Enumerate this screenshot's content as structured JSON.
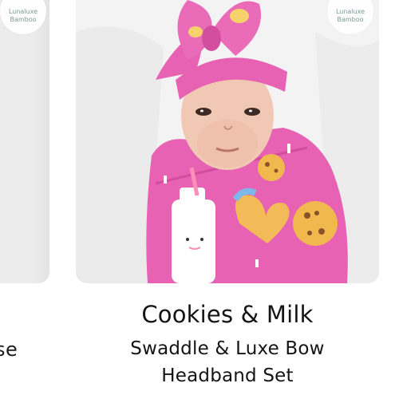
{
  "brand": {
    "line1": "Lunaluxe",
    "line2": "Bamboo",
    "logo_icon": "crescent-moon-icon"
  },
  "left_card": {
    "partial_title": "se"
  },
  "product": {
    "name": "Cookies & Milk",
    "subtitle_line1": "Swaddle & Luxe Bow",
    "subtitle_line2": "Headband Set",
    "image_alt": "Baby swaddled in pink cookies and milk print with matching bow headband"
  },
  "colors": {
    "print_pink": "#e862b3",
    "background_white": "#ffffff",
    "text_dark": "#141414",
    "logo_teal": "#7a9a95"
  }
}
